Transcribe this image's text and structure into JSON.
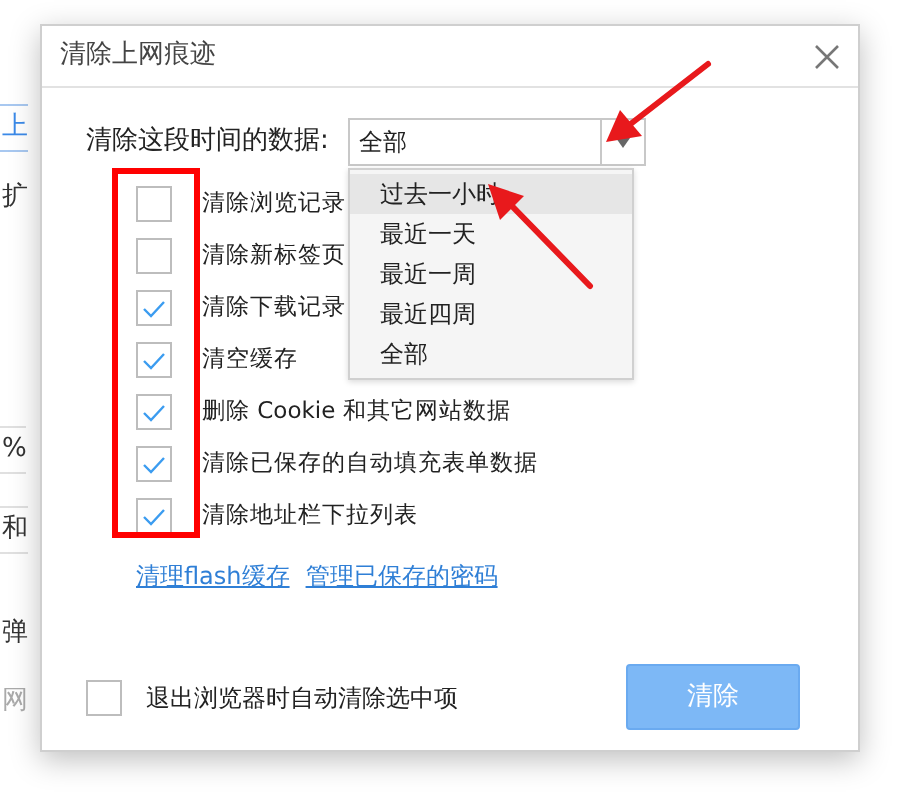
{
  "background_page": {
    "fragments": [
      {
        "text": "上",
        "kind": "tab"
      },
      {
        "text": "扩",
        "kind": "text"
      },
      {
        "text": "%",
        "kind": "field"
      },
      {
        "text": "和",
        "kind": "field"
      },
      {
        "text": "弹",
        "kind": "text"
      },
      {
        "text": "网",
        "kind": "muted"
      }
    ]
  },
  "dialog": {
    "title": "清除上网痕迹",
    "time_range": {
      "label": "清除这段时间的数据:",
      "value": "全部",
      "expanded": true,
      "options": [
        {
          "label": "过去一小时",
          "highlighted": true
        },
        {
          "label": "最近一天",
          "highlighted": false
        },
        {
          "label": "最近一周",
          "highlighted": false
        },
        {
          "label": "最近四周",
          "highlighted": false
        },
        {
          "label": "全部",
          "highlighted": false
        }
      ]
    },
    "checkboxes": [
      {
        "label": "清除浏览记录",
        "checked": false
      },
      {
        "label": "清除新标签页",
        "checked": false
      },
      {
        "label": "清除下载记录",
        "checked": true
      },
      {
        "label": "清空缓存",
        "checked": true
      },
      {
        "label": "删除 Cookie 和其它网站数据",
        "checked": true
      },
      {
        "label": "清除已保存的自动填充表单数据",
        "checked": true
      },
      {
        "label": "清除地址栏下拉列表",
        "checked": true
      }
    ],
    "links": [
      "清理flash缓存",
      "管理已保存的密码"
    ],
    "auto_clear": {
      "label": "退出浏览器时自动清除选中项",
      "checked": false
    },
    "clear_button": "清除"
  }
}
